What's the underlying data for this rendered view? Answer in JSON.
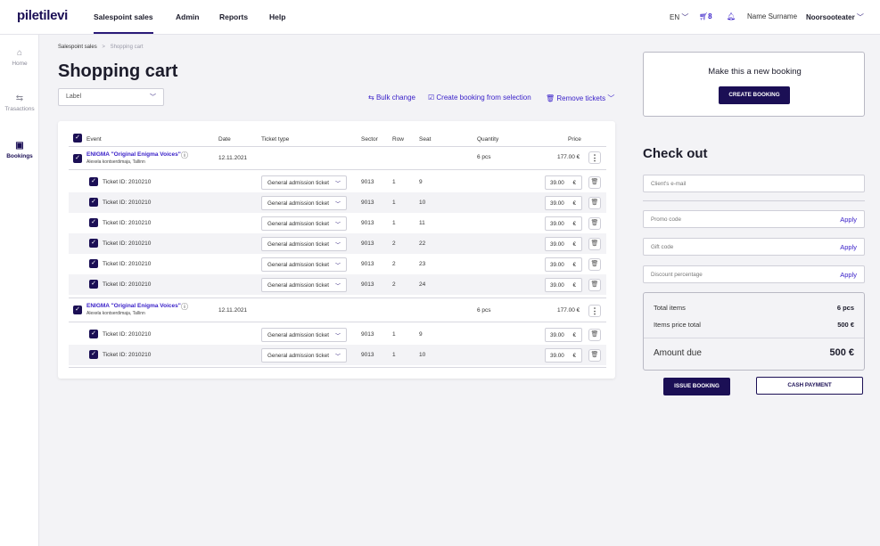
{
  "nav": {
    "logo": "piletilevi",
    "items": [
      "Salespoint sales",
      "Admin",
      "Reports",
      "Help"
    ],
    "lang": "EN",
    "cart_count": "8",
    "user_name": "Name Surname",
    "org": "Noorsooteater"
  },
  "rail": [
    {
      "icon": "home-icon",
      "label": "Home"
    },
    {
      "icon": "transactions-icon",
      "label": "Trasactions"
    },
    {
      "icon": "bookings-icon",
      "label": "Bookings"
    }
  ],
  "breadcrumb": {
    "parent": "Salespoint sales",
    "separator": ">",
    "current": "Shopping cart"
  },
  "title": "Shopping cart",
  "label_select": "Label",
  "actions": {
    "bulk_change": "Bulk change",
    "create_from_selection": "Create booking from selection",
    "remove_tickets": "Remove tickets"
  },
  "table": {
    "headers": [
      "Event",
      "Date",
      "Ticket type",
      "Sector",
      "Row",
      "Seat",
      "Quantity",
      "Price"
    ],
    "groups": [
      {
        "event": "ENIGMA \"Original Enigma Voices\"",
        "venue": "Alexela kontserdimaja, Tallinn",
        "date": "12.11.2021",
        "quantity": "6 pcs",
        "price": "177.00 €",
        "tickets": [
          {
            "id": "Ticket ID: 2010210",
            "type": "General admission ticket",
            "sector": "9013",
            "row": "1",
            "seat": "9",
            "price": "39.00",
            "currency": "€"
          },
          {
            "id": "Ticket ID: 2010210",
            "type": "General admission ticket",
            "sector": "9013",
            "row": "1",
            "seat": "10",
            "price": "39.00",
            "currency": "€"
          },
          {
            "id": "Ticket ID: 2010210",
            "type": "General admission ticket",
            "sector": "9013",
            "row": "1",
            "seat": "11",
            "price": "39.00",
            "currency": "€"
          },
          {
            "id": "Ticket ID: 2010210",
            "type": "General admission ticket",
            "sector": "9013",
            "row": "2",
            "seat": "22",
            "price": "39.00",
            "currency": "€"
          },
          {
            "id": "Ticket ID: 2010210",
            "type": "General admission ticket",
            "sector": "9013",
            "row": "2",
            "seat": "23",
            "price": "39.00",
            "currency": "€"
          },
          {
            "id": "Ticket ID: 2010210",
            "type": "General admission ticket",
            "sector": "9013",
            "row": "2",
            "seat": "24",
            "price": "39.00",
            "currency": "€"
          }
        ]
      },
      {
        "event": "ENIGMA \"Original Enigma Voices\"",
        "venue": "Alexela kontserdimaja, Tallinn",
        "date": "12.11.2021",
        "quantity": "6 pcs",
        "price": "177.00 €",
        "tickets": [
          {
            "id": "Ticket ID: 2010210",
            "type": "General admission ticket",
            "sector": "9013",
            "row": "1",
            "seat": "9",
            "price": "39.00",
            "currency": "€"
          },
          {
            "id": "Ticket ID: 2010210",
            "type": "General admission ticket",
            "sector": "9013",
            "row": "1",
            "seat": "10",
            "price": "39.00",
            "currency": "€"
          }
        ]
      }
    ]
  },
  "new_booking": {
    "title": "Make this a new booking",
    "button": "CREATE BOOKING"
  },
  "checkout": {
    "title": "Check out",
    "email_placeholder": "Client's e-mail",
    "promo_placeholder": "Promo code",
    "gift_placeholder": "Gift code",
    "discount_placeholder": "Discount percentage",
    "apply": "Apply",
    "total_items_label": "Total items",
    "total_items_value": "6 pcs",
    "items_price_label": "Items price total",
    "items_price_value": "500 €",
    "amount_due_label": "Amount due",
    "amount_due_value": "500 €",
    "issue_button": "ISSUE BOOKING",
    "cash_button": "CASH PAYMENT"
  },
  "colors": {
    "brand": "#1b0f55",
    "accent": "#3b22c9",
    "row_alt": "#f3f3f6"
  }
}
